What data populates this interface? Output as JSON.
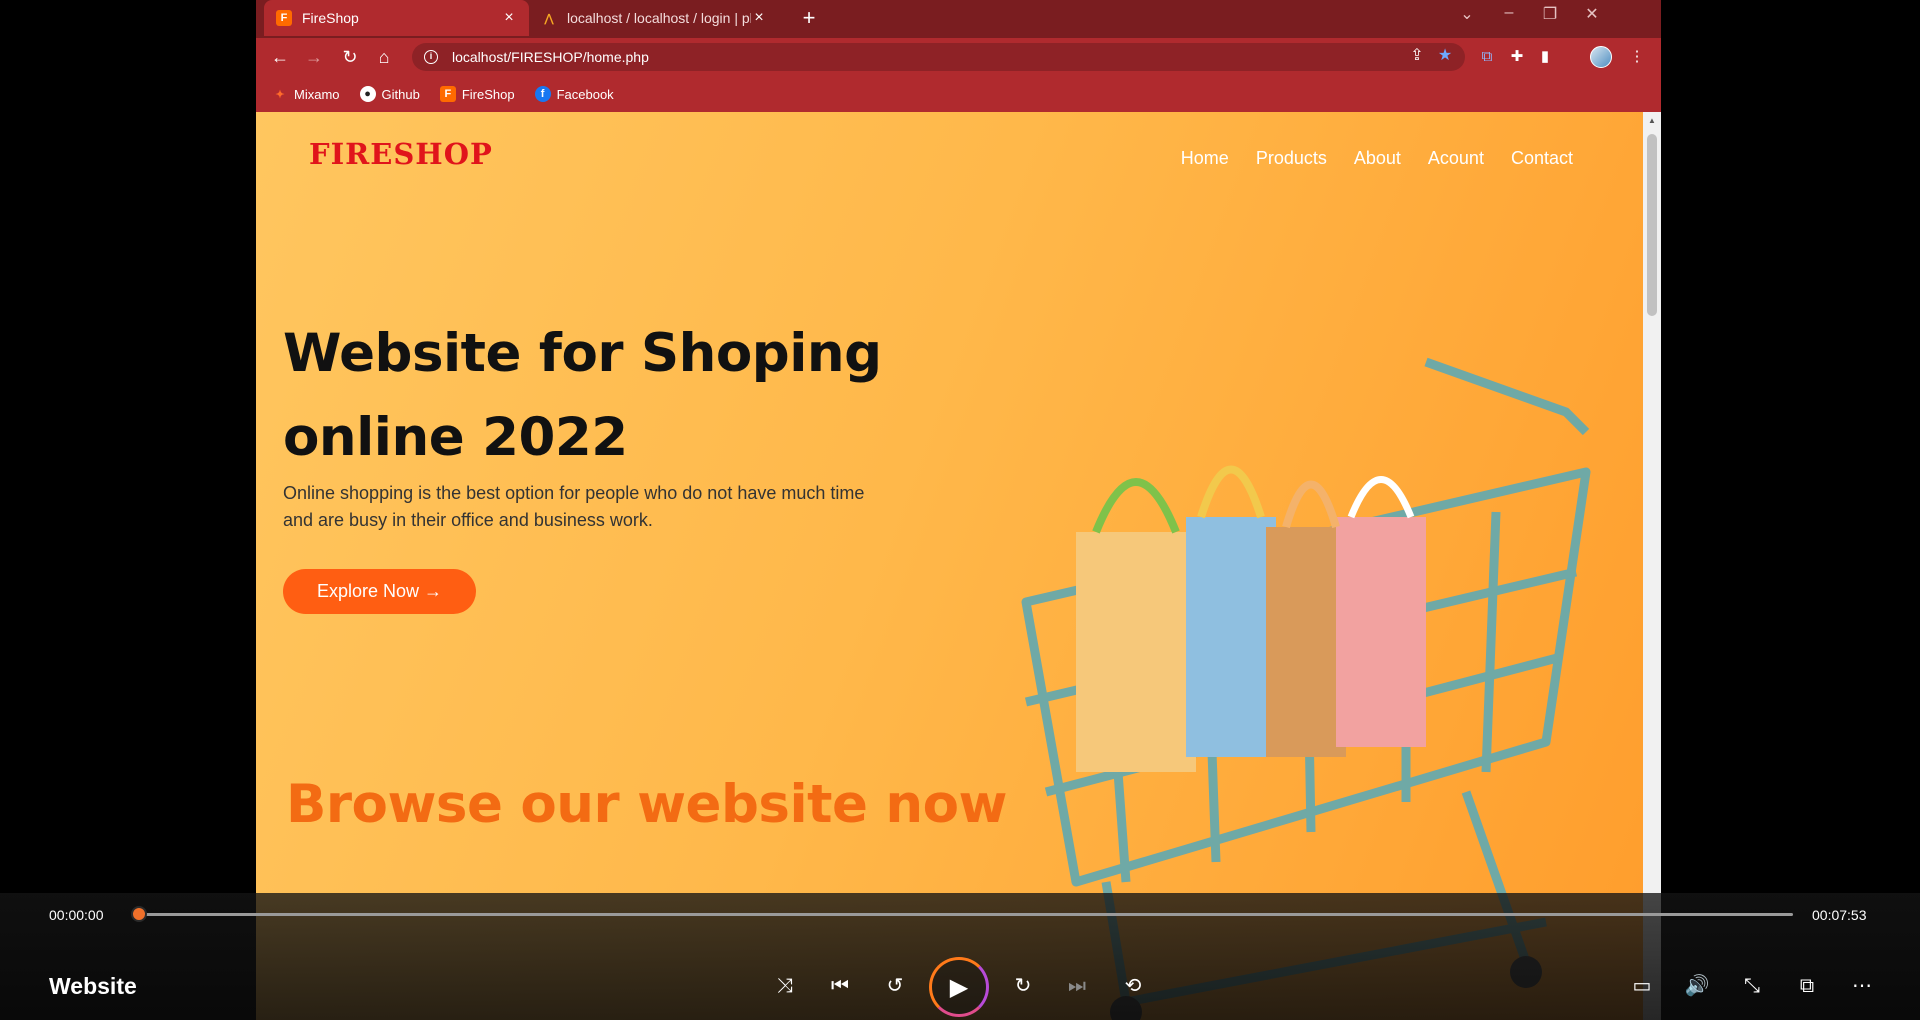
{
  "browser": {
    "tabs": [
      {
        "title": "FireShop",
        "favicon": "fireshop-favicon",
        "active": true
      },
      {
        "title": "localhost / localhost / login | php",
        "favicon": "phpmyadmin-favicon",
        "active": false
      }
    ],
    "url": "localhost/FIRESHOP/home.php",
    "bookmarks": [
      {
        "label": "Mixamo",
        "icon": "mixamo-icon"
      },
      {
        "label": "Github",
        "icon": "github-icon"
      },
      {
        "label": "FireShop",
        "icon": "fireshop-icon"
      },
      {
        "label": "Facebook",
        "icon": "facebook-icon"
      }
    ]
  },
  "site": {
    "logo": "FIRESHOP",
    "nav": [
      "Home",
      "Products",
      "About",
      "Acount",
      "Contact"
    ],
    "hero_title_line1": "Website for Shoping",
    "hero_title_line2": "online 2022",
    "hero_sub_line1": "Online shopping is the best option for people who do not have much time",
    "hero_sub_line2": "and are busy in their office and business work.",
    "cta": "Explore Now →",
    "browse": "Browse our website now"
  },
  "player": {
    "title": "Website",
    "current_time": "00:00:00",
    "total_time": "00:07:53",
    "progress": 0,
    "accent_color": "#f0702a"
  }
}
